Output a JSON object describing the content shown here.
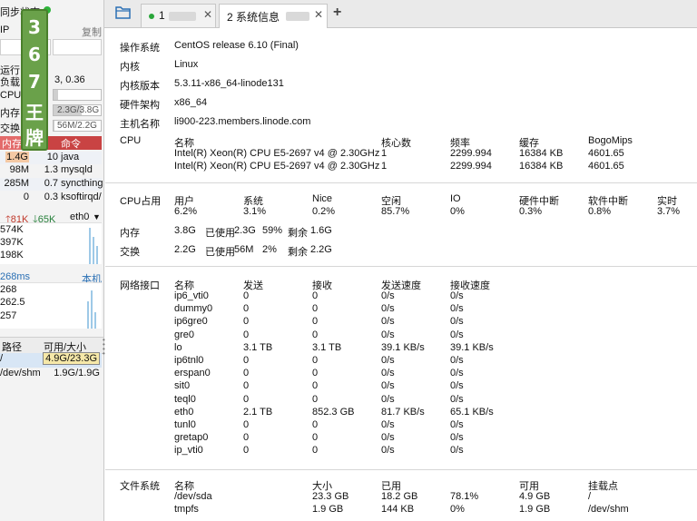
{
  "sidebar": {
    "sync_label": "同步状态",
    "ip_label": "IP",
    "copy_label": "复制",
    "uptime_label": "运行",
    "load_label": "负载",
    "load_value": "3, 0.36",
    "cpu_label": "CPU",
    "mem_label": "内存",
    "mem_value": "2.3G/3.8G",
    "mem_fraction": 0.59,
    "swap_label": "交换",
    "swap_value": "56M/2.2G",
    "swap_fraction": 0.02,
    "proc_headers": {
      "mem": "内存",
      "cmd": "命令"
    },
    "processes": [
      {
        "mem": "1.4G",
        "cpu": "10",
        "cmd": "java"
      },
      {
        "mem": "98M",
        "cpu": "1.3",
        "cmd": "mysqld"
      },
      {
        "mem": "285M",
        "cpu": "0.7",
        "cmd": "syncthing"
      },
      {
        "mem": "0",
        "cpu": "0.3",
        "cmd": "ksoftirqd/"
      }
    ],
    "net_up": "81K",
    "net_down": "65K",
    "net_iface": "eth0",
    "net_ticks": [
      "574K",
      "397K",
      "198K"
    ],
    "latency_label": "268ms",
    "latency_host": "本机",
    "latency_ticks": [
      "268",
      "262.5",
      "257"
    ],
    "disk_headers": {
      "path": "路径",
      "usage": "可用/大小"
    },
    "disks": [
      {
        "path": "/",
        "usage": "4.9G/23.3G"
      },
      {
        "path": "/dev/shm",
        "usage": "1.9G/1.9G"
      }
    ]
  },
  "tabs": [
    {
      "label": "1",
      "active": false
    },
    {
      "label": "2 系统信息",
      "active": true
    }
  ],
  "info": {
    "os_label": "操作系统",
    "os": "CentOS release 6.10 (Final)",
    "kernel_label": "内核",
    "kernel": "Linux",
    "kernel_ver_label": "内核版本",
    "kernel_ver": "5.3.11-x86_64-linode131",
    "arch_label": "硬件架构",
    "arch": "x86_64",
    "host_label": "主机名称",
    "host": "li900-223.members.linode.com",
    "cpu_label": "CPU",
    "cpu_headers": {
      "name": "名称",
      "cores": "核心数",
      "freq": "频率",
      "cache": "缓存",
      "bogo": "BogoMips"
    },
    "cpus": [
      {
        "name": "Intel(R) Xeon(R) CPU E5-2697 v4 @ 2.30GHz",
        "cores": "1",
        "freq": "2299.994",
        "cache": "16384 KB",
        "bogo": "4601.65"
      },
      {
        "name": "Intel(R) Xeon(R) CPU E5-2697 v4 @ 2.30GHz",
        "cores": "1",
        "freq": "2299.994",
        "cache": "16384 KB",
        "bogo": "4601.65"
      }
    ],
    "cpu_usage_label": "CPU占用",
    "cpu_usage": [
      {
        "label": "用户",
        "value": "6.2%"
      },
      {
        "label": "系统",
        "value": "3.1%"
      },
      {
        "label": "Nice",
        "value": "0.2%"
      },
      {
        "label": "空闲",
        "value": "85.7%"
      },
      {
        "label": "IO",
        "value": "0%"
      },
      {
        "label": "硬件中断",
        "value": "0.3%"
      },
      {
        "label": "软件中断",
        "value": "0.8%"
      },
      {
        "label": "实时",
        "value": "3.7%"
      }
    ],
    "mem_label": "内存",
    "mem_total": "3.8G",
    "used_label": "已使用",
    "mem_used": "2.3G",
    "mem_pct": "59%",
    "remain_label": "剩余",
    "mem_free": "1.6G",
    "swap_label": "交换",
    "swap_total": "2.2G",
    "swap_used": "56M",
    "swap_pct": "2%",
    "swap_free": "2.2G",
    "net_label": "网络接口",
    "net_headers": {
      "name": "名称",
      "sent": "发送",
      "recv": "接收",
      "send_rate": "发送速度",
      "recv_rate": "接收速度"
    },
    "interfaces": [
      {
        "name": "ip6_vti0",
        "sent": "0",
        "recv": "0",
        "send_rate": "0/s",
        "recv_rate": "0/s"
      },
      {
        "name": "dummy0",
        "sent": "0",
        "recv": "0",
        "send_rate": "0/s",
        "recv_rate": "0/s"
      },
      {
        "name": "ip6gre0",
        "sent": "0",
        "recv": "0",
        "send_rate": "0/s",
        "recv_rate": "0/s"
      },
      {
        "name": "gre0",
        "sent": "0",
        "recv": "0",
        "send_rate": "0/s",
        "recv_rate": "0/s"
      },
      {
        "name": "lo",
        "sent": "3.1 TB",
        "recv": "3.1 TB",
        "send_rate": "39.1 KB/s",
        "recv_rate": "39.1 KB/s"
      },
      {
        "name": "ip6tnl0",
        "sent": "0",
        "recv": "0",
        "send_rate": "0/s",
        "recv_rate": "0/s"
      },
      {
        "name": "erspan0",
        "sent": "0",
        "recv": "0",
        "send_rate": "0/s",
        "recv_rate": "0/s"
      },
      {
        "name": "sit0",
        "sent": "0",
        "recv": "0",
        "send_rate": "0/s",
        "recv_rate": "0/s"
      },
      {
        "name": "teql0",
        "sent": "0",
        "recv": "0",
        "send_rate": "0/s",
        "recv_rate": "0/s"
      },
      {
        "name": "eth0",
        "sent": "2.1 TB",
        "recv": "852.3 GB",
        "send_rate": "81.7 KB/s",
        "recv_rate": "65.1 KB/s"
      },
      {
        "name": "tunl0",
        "sent": "0",
        "recv": "0",
        "send_rate": "0/s",
        "recv_rate": "0/s"
      },
      {
        "name": "gretap0",
        "sent": "0",
        "recv": "0",
        "send_rate": "0/s",
        "recv_rate": "0/s"
      },
      {
        "name": "ip_vti0",
        "sent": "0",
        "recv": "0",
        "send_rate": "0/s",
        "recv_rate": "0/s"
      }
    ],
    "fs_label": "文件系统",
    "fs_headers": {
      "name": "名称",
      "size": "大小",
      "used": "已用",
      "avail": "可用",
      "mount": "挂载点"
    },
    "filesystems": [
      {
        "name": "/dev/sda",
        "size": "23.3 GB",
        "used": "18.2 GB",
        "pct": "78.1%",
        "avail": "4.9 GB",
        "mount": "/"
      },
      {
        "name": "tmpfs",
        "size": "1.9 GB",
        "used": "144 KB",
        "pct": "0%",
        "avail": "1.9 GB",
        "mount": "/dev/shm"
      }
    ]
  },
  "logo_text": [
    "3",
    "6",
    "7",
    "王",
    "牌"
  ],
  "colors": {
    "accent_green": "#2db43a",
    "proc_header": "#c94343",
    "net_graph": "#9ec9e7"
  }
}
